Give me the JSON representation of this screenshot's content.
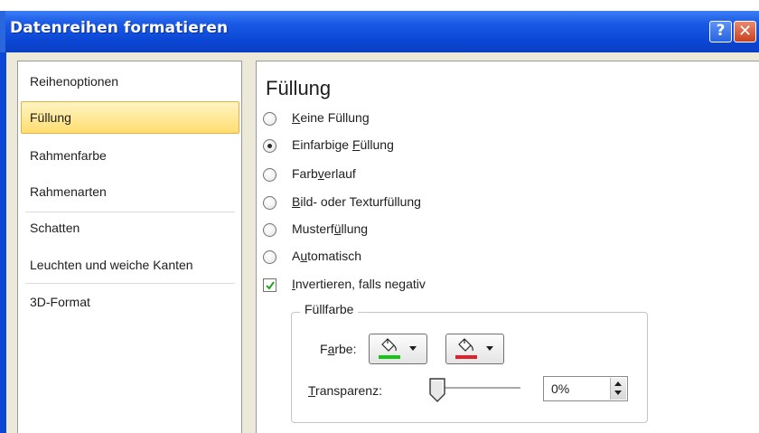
{
  "window": {
    "title": "Datenreihen formatieren",
    "help_label": "?",
    "close_label": "✕"
  },
  "sidebar": {
    "items": [
      {
        "label": "Reihenoptionen",
        "selected": false
      },
      {
        "label": "Füllung",
        "selected": true
      },
      {
        "label": "Rahmenfarbe",
        "selected": false
      },
      {
        "label": "Rahmenarten",
        "selected": false
      },
      {
        "label": "Schatten",
        "selected": false
      },
      {
        "label": "Leuchten und weiche Kanten",
        "selected": false
      },
      {
        "label": "3D-Format",
        "selected": false
      }
    ]
  },
  "fill": {
    "heading": "Füllung",
    "options": [
      {
        "pre": "",
        "key": "K",
        "post": "eine Füllung",
        "selected": false
      },
      {
        "pre": "Einfarbige ",
        "key": "F",
        "post": "üllung",
        "selected": true
      },
      {
        "pre": "Farb",
        "key": "v",
        "post": "erlauf",
        "selected": false
      },
      {
        "pre": "",
        "key": "B",
        "post": "ild- oder Texturfüllung",
        "selected": false
      },
      {
        "pre": "Musterf",
        "key": "ü",
        "post": "llung",
        "selected": false
      },
      {
        "pre": "A",
        "key": "u",
        "post": "tomatisch",
        "selected": false
      }
    ],
    "invert": {
      "pre": "",
      "key": "I",
      "post": "nvertieren, falls negativ",
      "checked": true
    },
    "group": {
      "legend": "Füllfarbe",
      "color_label": {
        "pre": "F",
        "key": "a",
        "post": "rbe:"
      },
      "color_buttons": [
        {
          "swatch": "#16c616"
        },
        {
          "swatch": "#e0202a"
        }
      ],
      "transparency_label": {
        "pre": "",
        "key": "T",
        "post": "ransparenz:"
      },
      "transparency_value": "0%",
      "transparency_level": 0
    }
  },
  "colors": {
    "title_blue": "#0b47d6",
    "selection": "#ffdd70",
    "close_red": "#c8421e"
  }
}
